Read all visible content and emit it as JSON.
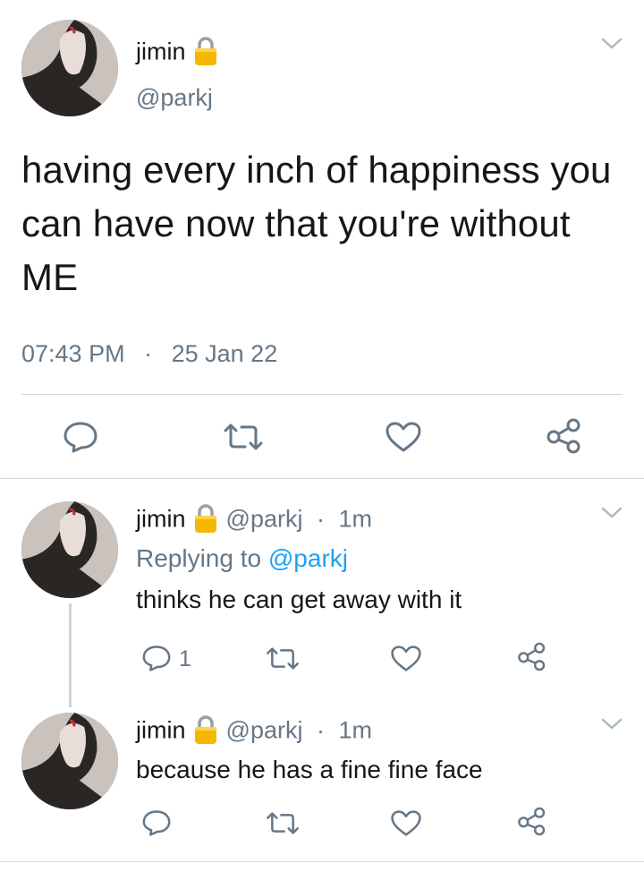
{
  "main_tweet": {
    "author_name": "jimin",
    "handle": "@parkj",
    "text": "having every inch of happiness you can have now that you're without ME",
    "time": "07:43 PM",
    "separator": "·",
    "date": "25 Jan 22"
  },
  "replies": [
    {
      "author_name": "jimin",
      "handle": "@parkj",
      "separator": "·",
      "time_ago": "1m",
      "replying_prefix": "Replying to",
      "replying_to": "@parkj",
      "text": "thinks he can get away with it",
      "reply_count": "1"
    },
    {
      "author_name": "jimin",
      "handle": "@parkj",
      "separator": "·",
      "time_ago": "1m",
      "text": "because he has a fine fine face"
    }
  ],
  "colors": {
    "text": "#14171a",
    "secondary": "#657786",
    "link": "#1da1f2",
    "divider": "#cfd9de",
    "lock": "#f5b800"
  },
  "icons": [
    "avatar",
    "lock-icon",
    "chevron-down-icon",
    "reply-icon",
    "retweet-icon",
    "like-icon",
    "share-icon"
  ]
}
